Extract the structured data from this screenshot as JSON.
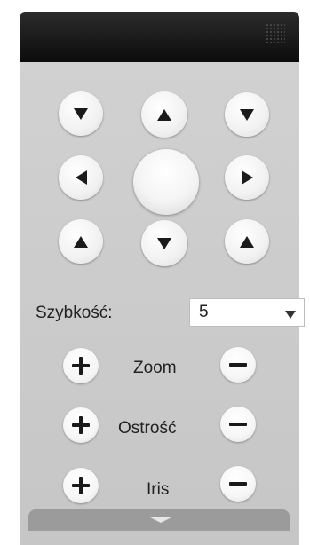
{
  "ptz": {
    "speed_label": "Szybkość:",
    "speed_value": "5",
    "zoom_label": "Zoom",
    "focus_label": "Ostrość",
    "iris_label": "Iris"
  }
}
